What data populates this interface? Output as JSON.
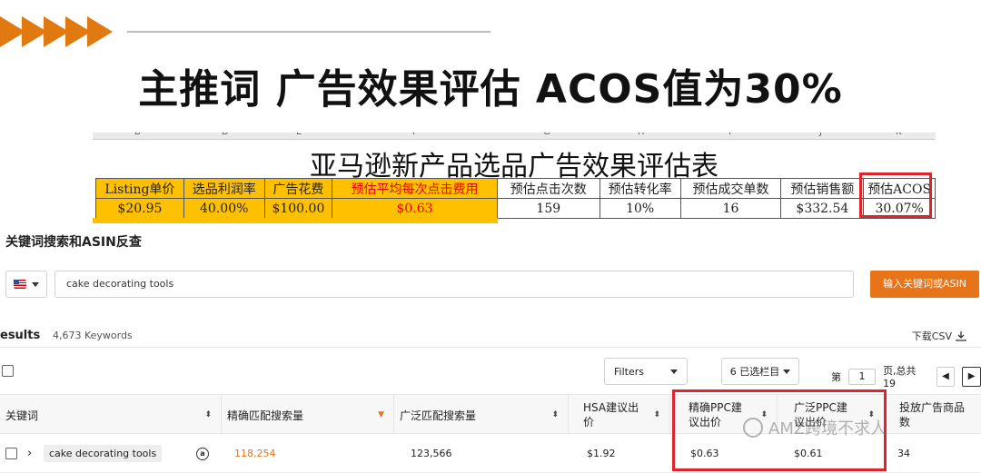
{
  "slide": {
    "title": "主推词 广告效果评估 ACOS值为30%"
  },
  "sheet": {
    "columns": [
      "B",
      "D",
      "E",
      "F",
      "G",
      "H",
      "I",
      "J",
      "K"
    ],
    "title": "亚马逊新产品选品广告效果评估表",
    "headers": [
      "Listing单价",
      "选品利润率",
      "广告花费",
      "预估平均每次点击费用",
      "预估点击次数",
      "预估转化率",
      "预估成交单数",
      "预估销售额",
      "预估ACOS"
    ],
    "values": [
      "$20.95",
      "40.00%",
      "$100.00",
      "$0.63",
      "159",
      "10%",
      "16",
      "$332.54",
      "30.07%"
    ]
  },
  "app": {
    "section_title": "关键词搜索和ASIN反查",
    "search_value": "cake decorating tools",
    "search_button": "输入关键词或ASIN",
    "results_label": "esults",
    "results_count": "4,673 Keywords",
    "download_label": "下载CSV",
    "filters_label": "Filters",
    "columns_label": "6 已选栏目",
    "pager": {
      "prefix": "第",
      "page": "1",
      "suffix": "页,总共 19"
    },
    "table_headers": [
      "关键词",
      "精确匹配搜索量",
      "广泛匹配搜索量",
      "HSA建议出价",
      "精确PPC建议出价",
      "广泛PPC建议出价",
      "投放广告商品数"
    ],
    "row": {
      "keyword": "cake decorating tools",
      "exact_volume": "118,254",
      "broad_volume": "123,566",
      "hsa_bid": "$1.92",
      "exact_ppc": "$0.63",
      "broad_ppc": "$0.61",
      "ad_products": "34"
    },
    "watermark": "AMZ跨境不求人"
  },
  "colors": {
    "accent_orange": "#e8741a",
    "highlight_red": "#e0242c",
    "sheet_yellow": "#ffc000"
  }
}
